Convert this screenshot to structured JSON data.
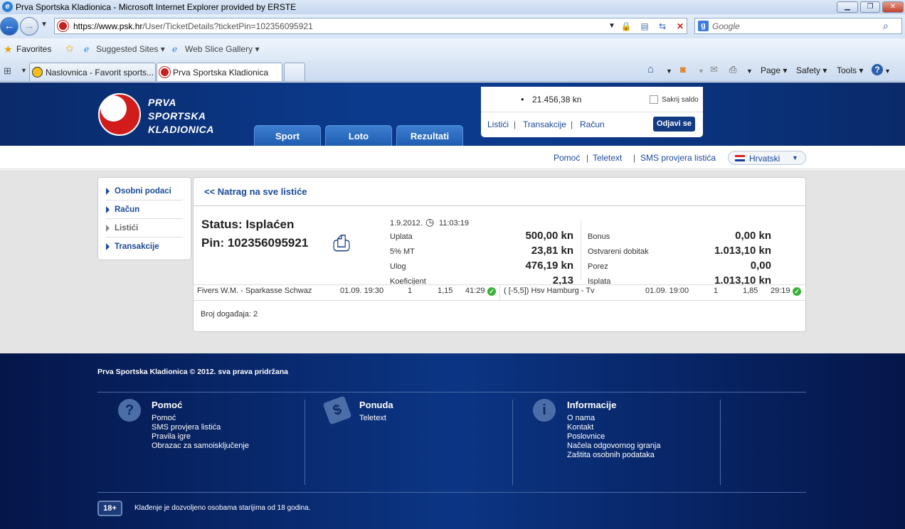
{
  "window": {
    "title": "Prva Sportska Kladionica - Microsoft Internet Explorer provided by ERSTE"
  },
  "address": {
    "url_host": "https://www.psk.hr",
    "url_path": "/User/TicketDetails?ticketPin=102356095921"
  },
  "search": {
    "placeholder": "Google"
  },
  "favbar": {
    "favorites": "Favorites",
    "suggested": "Suggested Sites",
    "webslice": "Web Slice Gallery"
  },
  "tabs": [
    {
      "label": "Naslovnica - Favorit sports..."
    },
    {
      "label": "Prva Sportska Kladionica"
    }
  ],
  "commandbar": {
    "page": "Page",
    "safety": "Safety",
    "tools": "Tools",
    "help": "?"
  },
  "site": {
    "logo": [
      "PRVA",
      "SPORTSKA",
      "KLADIONICA"
    ],
    "nav": [
      "Sport",
      "Loto",
      "Rezultati"
    ],
    "balance": "21.456,38 kn",
    "hide_balance": "Sakrij saldo",
    "account_links": [
      "Listići",
      "Transakcije",
      "Račun"
    ],
    "logout": "Odjavi se",
    "sub_links": [
      "Pomoć",
      "Teletext",
      "SMS provjera listića"
    ],
    "language": "Hrvatski"
  },
  "sidemenu": [
    "Osobni podaci",
    "Račun",
    "Listići",
    "Transakcije"
  ],
  "ticket": {
    "back": "<< Natrag na sve listiće",
    "status": "Status: Isplaćen",
    "pin": "Pin: 102356095921",
    "date": "1.9.2012.",
    "time": "11:03:19",
    "left": [
      {
        "label": "Uplata",
        "value": "500,00 kn"
      },
      {
        "label": "5% MT",
        "value": "23,81 kn"
      },
      {
        "label": "Ulog",
        "value": "476,19 kn"
      },
      {
        "label": "Koeficijent",
        "value": "2,13"
      }
    ],
    "right": [
      {
        "label": "Bonus",
        "value": "0,00 kn"
      },
      {
        "label": "Ostvareni dobitak",
        "value": "1.013,10 kn"
      },
      {
        "label": "Porez",
        "value": "0,00"
      },
      {
        "label": "Isplata",
        "value": "1.013,10 kn"
      }
    ],
    "events": [
      {
        "name": "Fivers W.M. - Sparkasse Schwaz",
        "date": "01.09. 19:30",
        "tip": "1",
        "odds": "1,15",
        "result": "41:29"
      },
      {
        "name": "( [-5,5]) Hsv Hamburg - Tv",
        "date": "01.09. 19:00",
        "tip": "1",
        "odds": "1,85",
        "result": "29:19"
      }
    ],
    "event_count": "Broj događaja: 2"
  },
  "footer": {
    "copyright": "Prva Sportska Kladionica © 2012. sva prava pridržana",
    "cols": [
      {
        "title": "Pomoć",
        "items": [
          "Pomoć",
          "SMS provjera listića",
          "Pravila igre",
          "Obrazac za samoisključenje"
        ]
      },
      {
        "title": "Ponuda",
        "items": [
          "Teletext"
        ]
      },
      {
        "title": "Informacije",
        "items": [
          "O nama",
          "Kontakt",
          "Poslovnice",
          "Načela odgovornog igranja",
          "Zaštita osobnih podataka"
        ]
      }
    ],
    "age_badge": "18+",
    "age_note": "Klađenje je dozvoljeno osobama starijima od 18 godina."
  }
}
